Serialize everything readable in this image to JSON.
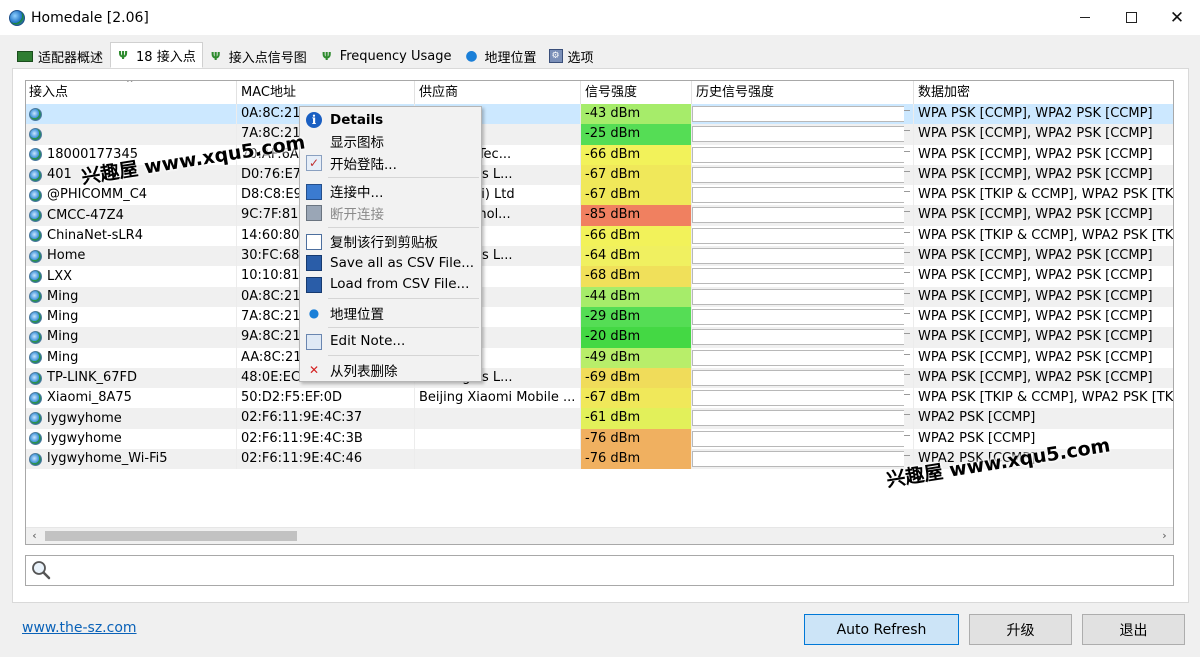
{
  "window": {
    "title": "Homedale [2.06]",
    "close_glyph": "✕"
  },
  "tabs": [
    {
      "label": "适配器概述",
      "icon": "board-icon"
    },
    {
      "label": "18 接入点",
      "icon": "antenna-icon"
    },
    {
      "label": "接入点信号图",
      "icon": "antenna-icon"
    },
    {
      "label": "Frequency Usage",
      "icon": "antenna-icon"
    },
    {
      "label": "地理位置",
      "icon": "pin-icon"
    },
    {
      "label": "选项",
      "icon": "options-icon"
    }
  ],
  "active_tab": 1,
  "table": {
    "columns": [
      "接入点",
      "MAC地址",
      "供应商",
      "信号强度",
      "历史信号强度",
      "数据加密"
    ],
    "rows": [
      {
        "name": "",
        "mac": "0A:8C:21:2",
        "vendor": "",
        "signal": "-43 dBm",
        "color": "#a6ec6a",
        "enc": "WPA PSK [CCMP], WPA2 PSK [CCMP]"
      },
      {
        "name": "",
        "mac": "7A:8C:21:3",
        "vendor": "",
        "signal": "-25 dBm",
        "color": "#55dd55",
        "enc": "WPA PSK [CCMP], WPA2 PSK [CCMP]"
      },
      {
        "name": "18000177345",
        "mac": "70:AF:6A:A",
        "vendor": "Fenglian Tec...",
        "signal": "-66 dBm",
        "color": "#f2f25a",
        "enc": "WPA PSK [CCMP], WPA2 PSK [CCMP]"
      },
      {
        "name": "401",
        "mac": "D0:76:E7:2",
        "vendor": "chnologies L...",
        "signal": "-67 dBm",
        "color": "#f0e85a",
        "enc": "WPA PSK [CCMP], WPA2 PSK [CCMP]"
      },
      {
        "name": "@PHICOMM_C4",
        "mac": "D8:C8:E9:3",
        "vendor": "(Shanghai) Ltd",
        "signal": "-67 dBm",
        "color": "#f0e85a",
        "enc": "WPA PSK [TKIP & CCMP], WPA2 PSK [TK"
      },
      {
        "name": "CMCC-47Z4",
        "mac": "9C:7F:81:D",
        "vendor": "Fast Technol...",
        "signal": "-85 dBm",
        "color": "#f08060",
        "enc": "WPA PSK [CCMP], WPA2 PSK [CCMP]"
      },
      {
        "name": "ChinaNet-sLR4",
        "mac": "14:60:80:6",
        "vendor": "ration",
        "signal": "-66 dBm",
        "color": "#f2f25a",
        "enc": "WPA PSK [TKIP & CCMP], WPA2 PSK [TK"
      },
      {
        "name": "Home",
        "mac": "30:FC:68:2",
        "vendor": "chnologies L...",
        "signal": "-64 dBm",
        "color": "#f0f060",
        "enc": "WPA PSK [CCMP], WPA2 PSK [CCMP]"
      },
      {
        "name": "LXX",
        "mac": "10:10:81:8",
        "vendor": "ration",
        "signal": "-68 dBm",
        "color": "#f0e05a",
        "enc": "WPA PSK [CCMP], WPA2 PSK [CCMP]"
      },
      {
        "name": "Ming",
        "mac": "0A:8C:21:2",
        "vendor": "",
        "signal": "-44 dBm",
        "color": "#a6ec6a",
        "enc": "WPA PSK [CCMP], WPA2 PSK [CCMP]"
      },
      {
        "name": "Ming",
        "mac": "7A:8C:21:3",
        "vendor": "",
        "signal": "-29 dBm",
        "color": "#55dd55",
        "enc": "WPA PSK [CCMP], WPA2 PSK [CCMP]"
      },
      {
        "name": "Ming",
        "mac": "9A:8C:21:3",
        "vendor": "",
        "signal": "-20 dBm",
        "color": "#44d844",
        "enc": "WPA PSK [CCMP], WPA2 PSK [CCMP]"
      },
      {
        "name": "Ming",
        "mac": "AA:8C:21:2",
        "vendor": "",
        "signal": "-49 dBm",
        "color": "#b8ee6a",
        "enc": "WPA PSK [CCMP], WPA2 PSK [CCMP]"
      },
      {
        "name": "TP-LINK_67FD",
        "mac": "48:0E:EC:3",
        "vendor": "chnologies L...",
        "signal": "-69 dBm",
        "color": "#f0dc5a",
        "enc": "WPA PSK [CCMP], WPA2 PSK [CCMP]"
      },
      {
        "name": "Xiaomi_8A75",
        "mac": "50:D2:F5:EF:0D",
        "vendor": "Beijing Xiaomi Mobile ...",
        "signal": "-67 dBm",
        "color": "#f0e85a",
        "enc": "WPA PSK [TKIP & CCMP], WPA2 PSK [TK"
      },
      {
        "name": "lygwyhome",
        "mac": "02:F6:11:9E:4C:37",
        "vendor": "",
        "signal": "-61 dBm",
        "color": "#e2f05a",
        "enc": "WPA2 PSK [CCMP]"
      },
      {
        "name": "lygwyhome",
        "mac": "02:F6:11:9E:4C:3B",
        "vendor": "",
        "signal": "-76 dBm",
        "color": "#f0b060",
        "enc": "WPA2 PSK [CCMP]"
      },
      {
        "name": "lygwyhome_Wi-Fi5",
        "mac": "02:F6:11:9E:4C:46",
        "vendor": "",
        "signal": "-76 dBm",
        "color": "#f0b060",
        "enc": "WPA2 PSK [CCMP]"
      }
    ],
    "scroll_left": "‹",
    "scroll_right": "›"
  },
  "context_menu": {
    "items": [
      {
        "label": "Details",
        "icon": "info-icon",
        "bold": true
      },
      {
        "label": "显示图标",
        "icon": ""
      },
      {
        "label": "开始登陆...",
        "icon": "login-icon"
      },
      {
        "sep": true
      },
      {
        "label": "连接中...",
        "icon": "connect-icon"
      },
      {
        "label": "断开连接",
        "icon": "disconnect-icon",
        "disabled": true
      },
      {
        "sep": true
      },
      {
        "label": "复制该行到剪贴板",
        "icon": "copy-icon"
      },
      {
        "label": "Save all as CSV File...",
        "icon": "save-icon"
      },
      {
        "label": "Load from CSV File...",
        "icon": "load-icon"
      },
      {
        "sep": true
      },
      {
        "label": "地理位置",
        "icon": "pin-icon"
      },
      {
        "sep": true
      },
      {
        "label": "Edit Note...",
        "icon": "note-icon"
      },
      {
        "sep": true
      },
      {
        "label": "从列表删除",
        "icon": "delete-icon"
      }
    ]
  },
  "watermark": "兴趣屋 www.xqu5.com",
  "footer": {
    "link": "www.the-sz.com",
    "auto_refresh": "Auto Refresh",
    "upgrade": "升级",
    "exit": "退出"
  }
}
